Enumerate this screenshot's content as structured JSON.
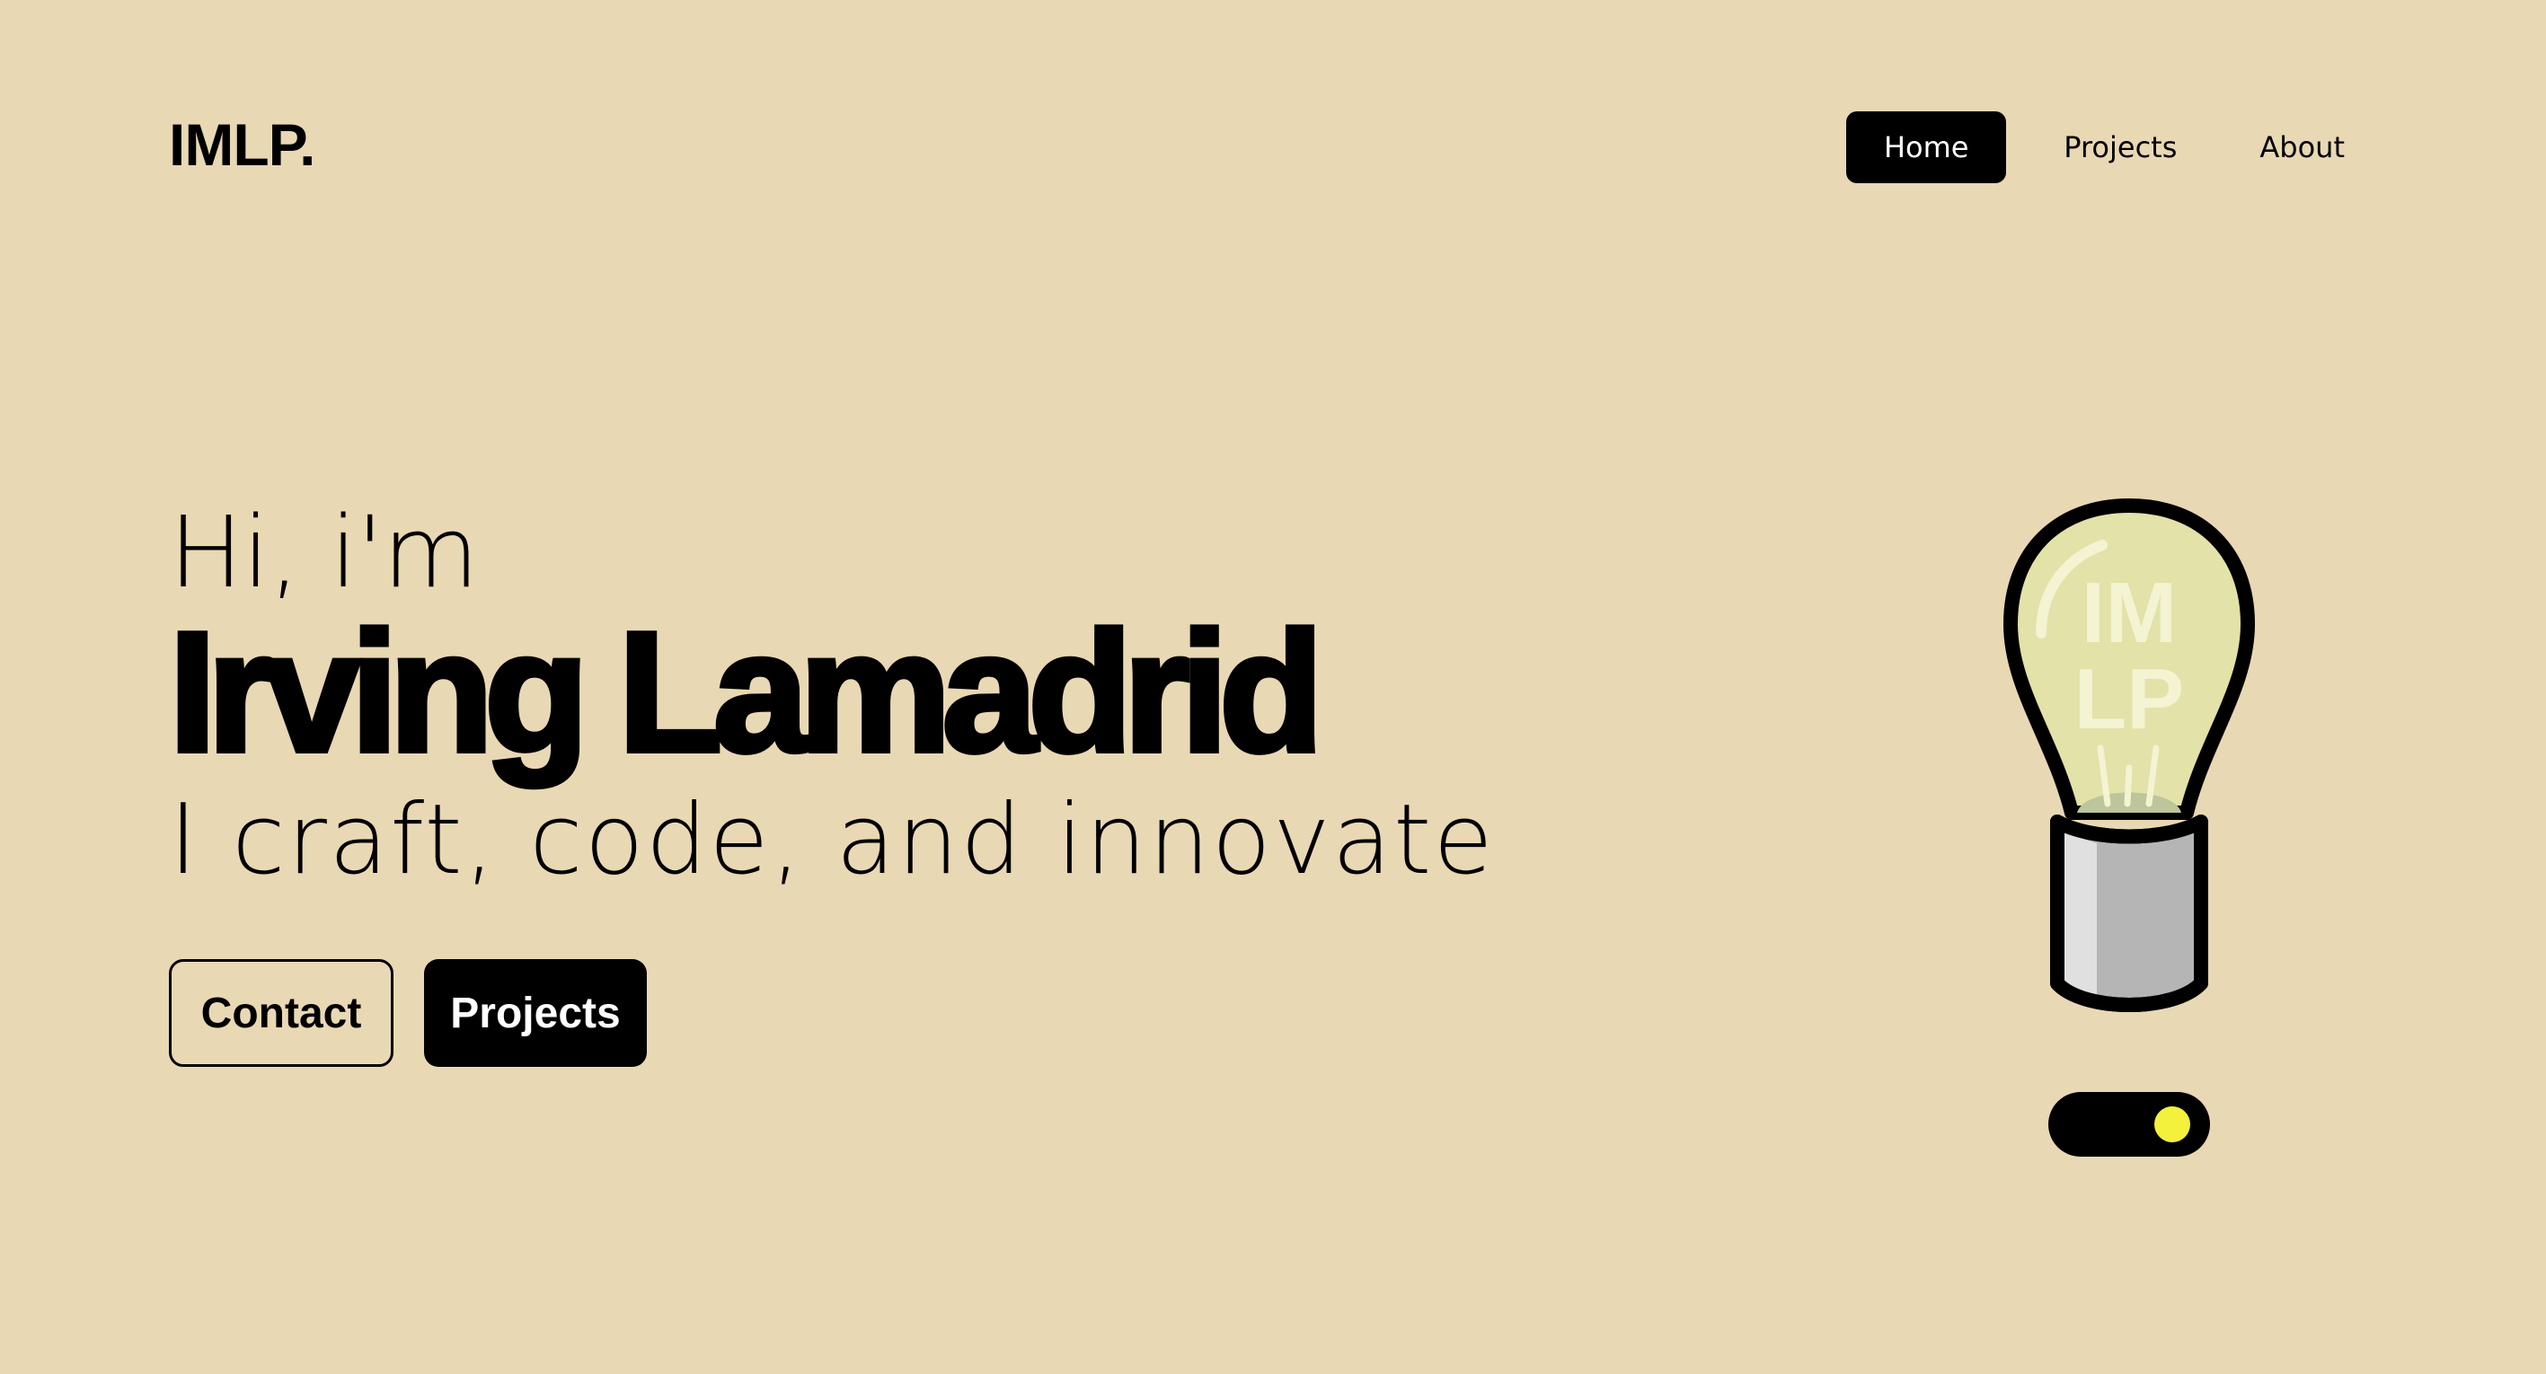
{
  "header": {
    "logo": "IMLP.",
    "nav": [
      {
        "label": "Home",
        "active": true
      },
      {
        "label": "Projects",
        "active": false
      },
      {
        "label": "About",
        "active": false
      }
    ]
  },
  "hero": {
    "greeting": "Hi, i'm",
    "name": "Irving Lamadrid",
    "tagline": "I craft, code, and innovate",
    "buttons": {
      "contact": "Contact",
      "projects": "Projects"
    }
  },
  "illustration": {
    "icon": "lightbulb-icon",
    "bulb_text_line1": "IM",
    "bulb_text_line2": "LP"
  },
  "toggle": {
    "state": "on"
  },
  "colors": {
    "background": "#E9D8B4",
    "accent": "#000000",
    "bulb_glass": "#E2E2A9",
    "toggle_knob": "#F4F13C"
  }
}
